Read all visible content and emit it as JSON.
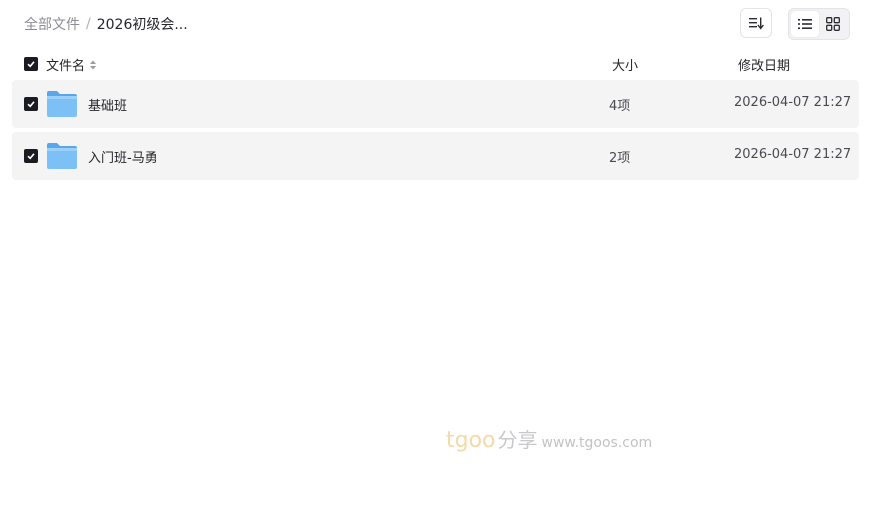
{
  "breadcrumb": {
    "root": "全部文件",
    "separator": "/",
    "current": "2026初级会..."
  },
  "toolbar": {
    "sort_icon": "sort-list-icon",
    "view_list_icon": "list-view-icon",
    "view_grid_icon": "grid-view-icon",
    "active_view": "list"
  },
  "table": {
    "headers": {
      "name": "文件名",
      "size": "大小",
      "date": "修改日期"
    },
    "select_all_checked": true,
    "rows": [
      {
        "name": "基础班",
        "size": "4项",
        "date": "2026-04-07 21:27",
        "checked": true,
        "icon": "folder-icon"
      },
      {
        "name": "入门班-马勇",
        "size": "2项",
        "date": "2026-04-07 21:27",
        "checked": true,
        "icon": "folder-icon"
      }
    ]
  },
  "watermark": {
    "brand": "tgoo",
    "brand_suffix": "分享",
    "url": "www.tgoos.com"
  },
  "colors": {
    "row_bg": "#f4f4f5",
    "checkbox": "#1b1c21",
    "folder_blue": "#6db4f2",
    "watermark_orange": "#f5d9a8"
  }
}
